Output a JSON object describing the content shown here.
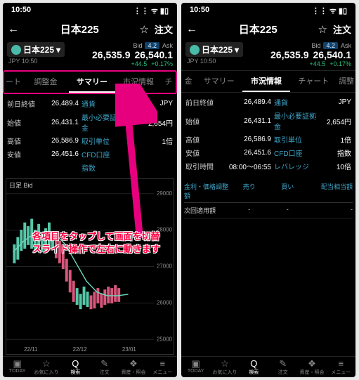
{
  "status": {
    "time": "10:50"
  },
  "title_bar": {
    "back": "←",
    "title": "日本225",
    "star": "☆",
    "order": "注文"
  },
  "ticker": {
    "name": "日本225",
    "caret": "▾",
    "sub": "JPY 10:50",
    "bid_label": "Bid",
    "ask_label": "Ask",
    "spread": "4.2",
    "bid_price": "26,535.9",
    "ask_price": "26,540.1",
    "chg_abs": "+44.5",
    "chg_pct": "+0.17%"
  },
  "left": {
    "tabs": {
      "edge_left": "ート",
      "t1": "調整金",
      "t2": "サマリー",
      "t3": "市況情報",
      "edge_right": "チ"
    },
    "rows": [
      {
        "l1": "前日終値",
        "v1": "26,489.4",
        "l2": "通貨",
        "v2": "JPY"
      },
      {
        "l1": "始値",
        "v1": "26,431.1",
        "l2": "最小必要証拠金",
        "v2": "2,654円"
      },
      {
        "l1": "高値",
        "v1": "26,586.9",
        "l2": "取引単位",
        "v2": "1倍"
      },
      {
        "l1": "安値",
        "v1": "26,451.6",
        "l2": "CFD口座",
        "v2": ""
      },
      {
        "l1": "",
        "v1": "",
        "l2": "指数",
        "v2": ""
      }
    ],
    "chart": {
      "title": "日足 Bid",
      "y_top": "29000",
      "y2": "28000",
      "y3": "27000",
      "y4": "26000",
      "y_bot": "25000",
      "x1": "22/11",
      "x2": "22/12",
      "x3": "23/01"
    },
    "annotation": {
      "line1": "各項目をタップして画面を切替",
      "line2": "スライド操作で左右に動きます"
    }
  },
  "right": {
    "tabs": {
      "edge_left": "金",
      "t1": "サマリー",
      "t2": "市況情報",
      "t3": "チャート",
      "edge_right": "調整"
    },
    "rows": [
      {
        "l1": "前日終値",
        "v1": "26,489.4",
        "l2": "通貨",
        "v2": "JPY"
      },
      {
        "l1": "始値",
        "v1": "26,431.1",
        "l2": "最小必要証拠金",
        "v2": "2,654円"
      },
      {
        "l1": "高値",
        "v1": "26,586.9",
        "l2": "取引単位",
        "v2": "1倍"
      },
      {
        "l1": "安値",
        "v1": "26,451.6",
        "l2": "CFD口座",
        "v2": "指数"
      },
      {
        "l1": "取引時間",
        "v1": "08:00～06:55",
        "l2": "レバレッジ",
        "v2": "10倍"
      }
    ],
    "adj": {
      "h1": "金利・価格調整額",
      "h2": "売り",
      "h3": "買い",
      "h4": "配当相当額",
      "row_label": "次回適用額",
      "dash": "-"
    }
  },
  "nav": {
    "items": [
      {
        "icon": "▣",
        "label": "TODAY"
      },
      {
        "icon": "☆",
        "label": "お気に入り"
      },
      {
        "icon": "Q",
        "label": "検索"
      },
      {
        "icon": "✎",
        "label": "注文"
      },
      {
        "icon": "❖",
        "label": "資産・照会"
      },
      {
        "icon": "≡",
        "label": "メニュー"
      }
    ]
  },
  "chart_data": {
    "type": "line",
    "title": "日足 Bid",
    "ylim": [
      25000,
      29000
    ],
    "x": [
      "22/11",
      "22/12",
      "23/01"
    ],
    "series": [
      {
        "name": "candles_area",
        "values": [
          27500,
          27800,
          28200,
          28100,
          27900,
          28300,
          27700,
          28000,
          27800,
          27600,
          27400,
          27100,
          26600,
          26200,
          26100,
          26500,
          26300,
          26400,
          26450,
          26500
        ]
      },
      {
        "name": "ma",
        "values": [
          27600,
          27700,
          27800,
          27850,
          27900,
          27850,
          27800,
          27750,
          27700,
          27600,
          27450,
          27200,
          27000,
          26800,
          26650,
          26550,
          26500,
          26480,
          26470,
          26480
        ]
      }
    ]
  }
}
